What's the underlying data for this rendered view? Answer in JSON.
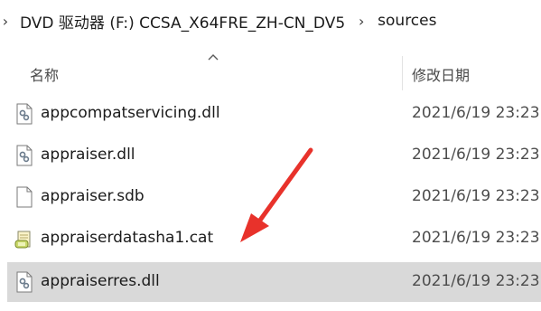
{
  "breadcrumb": {
    "drive": "DVD 驱动器 (F:) CCSA_X64FRE_ZH-CN_DV5",
    "folder": "sources"
  },
  "columns": {
    "name": "名称",
    "date_modified": "修改日期"
  },
  "files": [
    {
      "name": "appcompatservicing.dll",
      "date": "2021/6/19 23:23",
      "icon": "dll-settings-icon",
      "selected": false
    },
    {
      "name": "appraiser.dll",
      "date": "2021/6/19 23:23",
      "icon": "dll-settings-icon",
      "selected": false
    },
    {
      "name": "appraiser.sdb",
      "date": "2021/6/19 23:23",
      "icon": "blank-file-icon",
      "selected": false
    },
    {
      "name": "appraiserdatasha1.cat",
      "date": "2021/6/19 23:23",
      "icon": "security-catalog-icon",
      "selected": false
    },
    {
      "name": "appraiserres.dll",
      "date": "2021/6/19 23:23",
      "icon": "dll-settings-icon",
      "selected": true
    }
  ],
  "colors": {
    "selected_row": "#d9d9d9",
    "annotation_arrow": "#e8322b"
  }
}
